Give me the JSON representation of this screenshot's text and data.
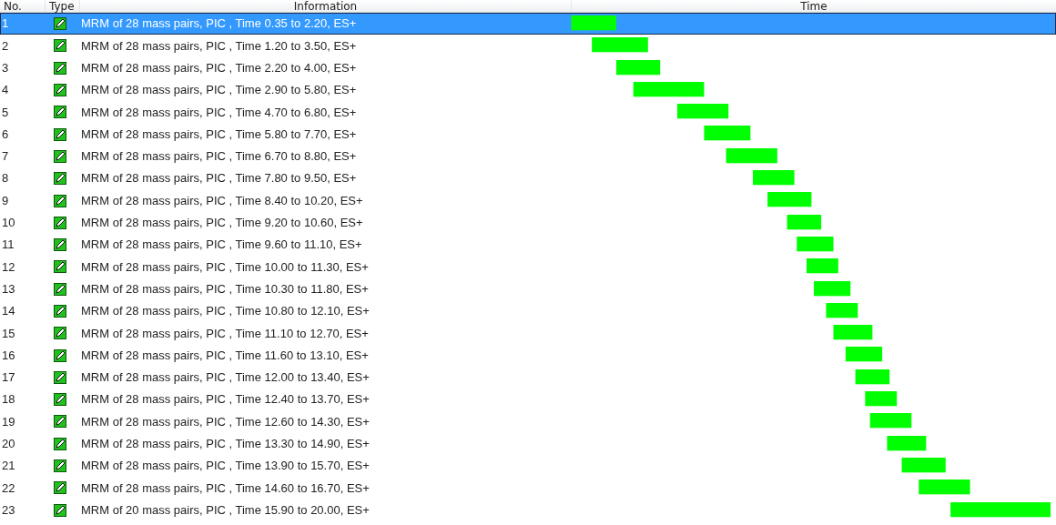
{
  "table": {
    "columns": [
      "No.",
      "Type",
      "Information",
      "Time"
    ],
    "rows": [
      {
        "no": "1",
        "info": "MRM of 28 mass pairs, PIC , Time 0.35 to 2.20, ES+",
        "selected": true
      },
      {
        "no": "2",
        "info": "MRM of 28 mass pairs, PIC , Time 1.20 to 3.50, ES+",
        "selected": false
      },
      {
        "no": "3",
        "info": "MRM of 28 mass pairs, PIC , Time 2.20 to 4.00, ES+",
        "selected": false
      },
      {
        "no": "4",
        "info": "MRM of 28 mass pairs, PIC , Time 2.90 to 5.80, ES+",
        "selected": false
      },
      {
        "no": "5",
        "info": "MRM of 28 mass pairs, PIC , Time 4.70 to 6.80, ES+",
        "selected": false
      },
      {
        "no": "6",
        "info": "MRM of 28 mass pairs, PIC , Time 5.80 to 7.70, ES+",
        "selected": false
      },
      {
        "no": "7",
        "info": "MRM of 28 mass pairs, PIC , Time 6.70 to 8.80, ES+",
        "selected": false
      },
      {
        "no": "8",
        "info": "MRM of 28 mass pairs, PIC , Time 7.80 to 9.50, ES+",
        "selected": false
      },
      {
        "no": "9",
        "info": "MRM of 28 mass pairs, PIC , Time 8.40 to 10.20, ES+",
        "selected": false
      },
      {
        "no": "10",
        "info": "MRM of 28 mass pairs, PIC , Time 9.20 to 10.60, ES+",
        "selected": false
      },
      {
        "no": "11",
        "info": "MRM of 28 mass pairs, PIC , Time 9.60 to 11.10, ES+",
        "selected": false
      },
      {
        "no": "12",
        "info": "MRM of 28 mass pairs, PIC , Time 10.00 to 11.30, ES+",
        "selected": false
      },
      {
        "no": "13",
        "info": "MRM of 28 mass pairs, PIC , Time 10.30 to 11.80, ES+",
        "selected": false
      },
      {
        "no": "14",
        "info": "MRM of 28 mass pairs, PIC , Time 10.80 to 12.10, ES+",
        "selected": false
      },
      {
        "no": "15",
        "info": "MRM of 28 mass pairs, PIC , Time 11.10 to 12.70, ES+",
        "selected": false
      },
      {
        "no": "16",
        "info": "MRM of 28 mass pairs, PIC , Time 11.60 to 13.10, ES+",
        "selected": false
      },
      {
        "no": "17",
        "info": "MRM of 28 mass pairs, PIC , Time 12.00 to 13.40, ES+",
        "selected": false
      },
      {
        "no": "18",
        "info": "MRM of 28 mass pairs, PIC , Time 12.40 to 13.70, ES+",
        "selected": false
      },
      {
        "no": "19",
        "info": "MRM of 28 mass pairs, PIC , Time 12.60 to 14.30, ES+",
        "selected": false
      },
      {
        "no": "20",
        "info": "MRM of 28 mass pairs, PIC , Time 13.30 to 14.90, ES+",
        "selected": false
      },
      {
        "no": "21",
        "info": "MRM of 28 mass pairs, PIC , Time 13.90 to 15.70, ES+",
        "selected": false
      },
      {
        "no": "22",
        "info": "MRM of 28 mass pairs, PIC , Time 14.60 to 16.70, ES+",
        "selected": false
      },
      {
        "no": "23",
        "info": "MRM of 20 mass pairs, PIC , Time 15.90 to 20.00, ES+",
        "selected": false
      }
    ]
  }
}
